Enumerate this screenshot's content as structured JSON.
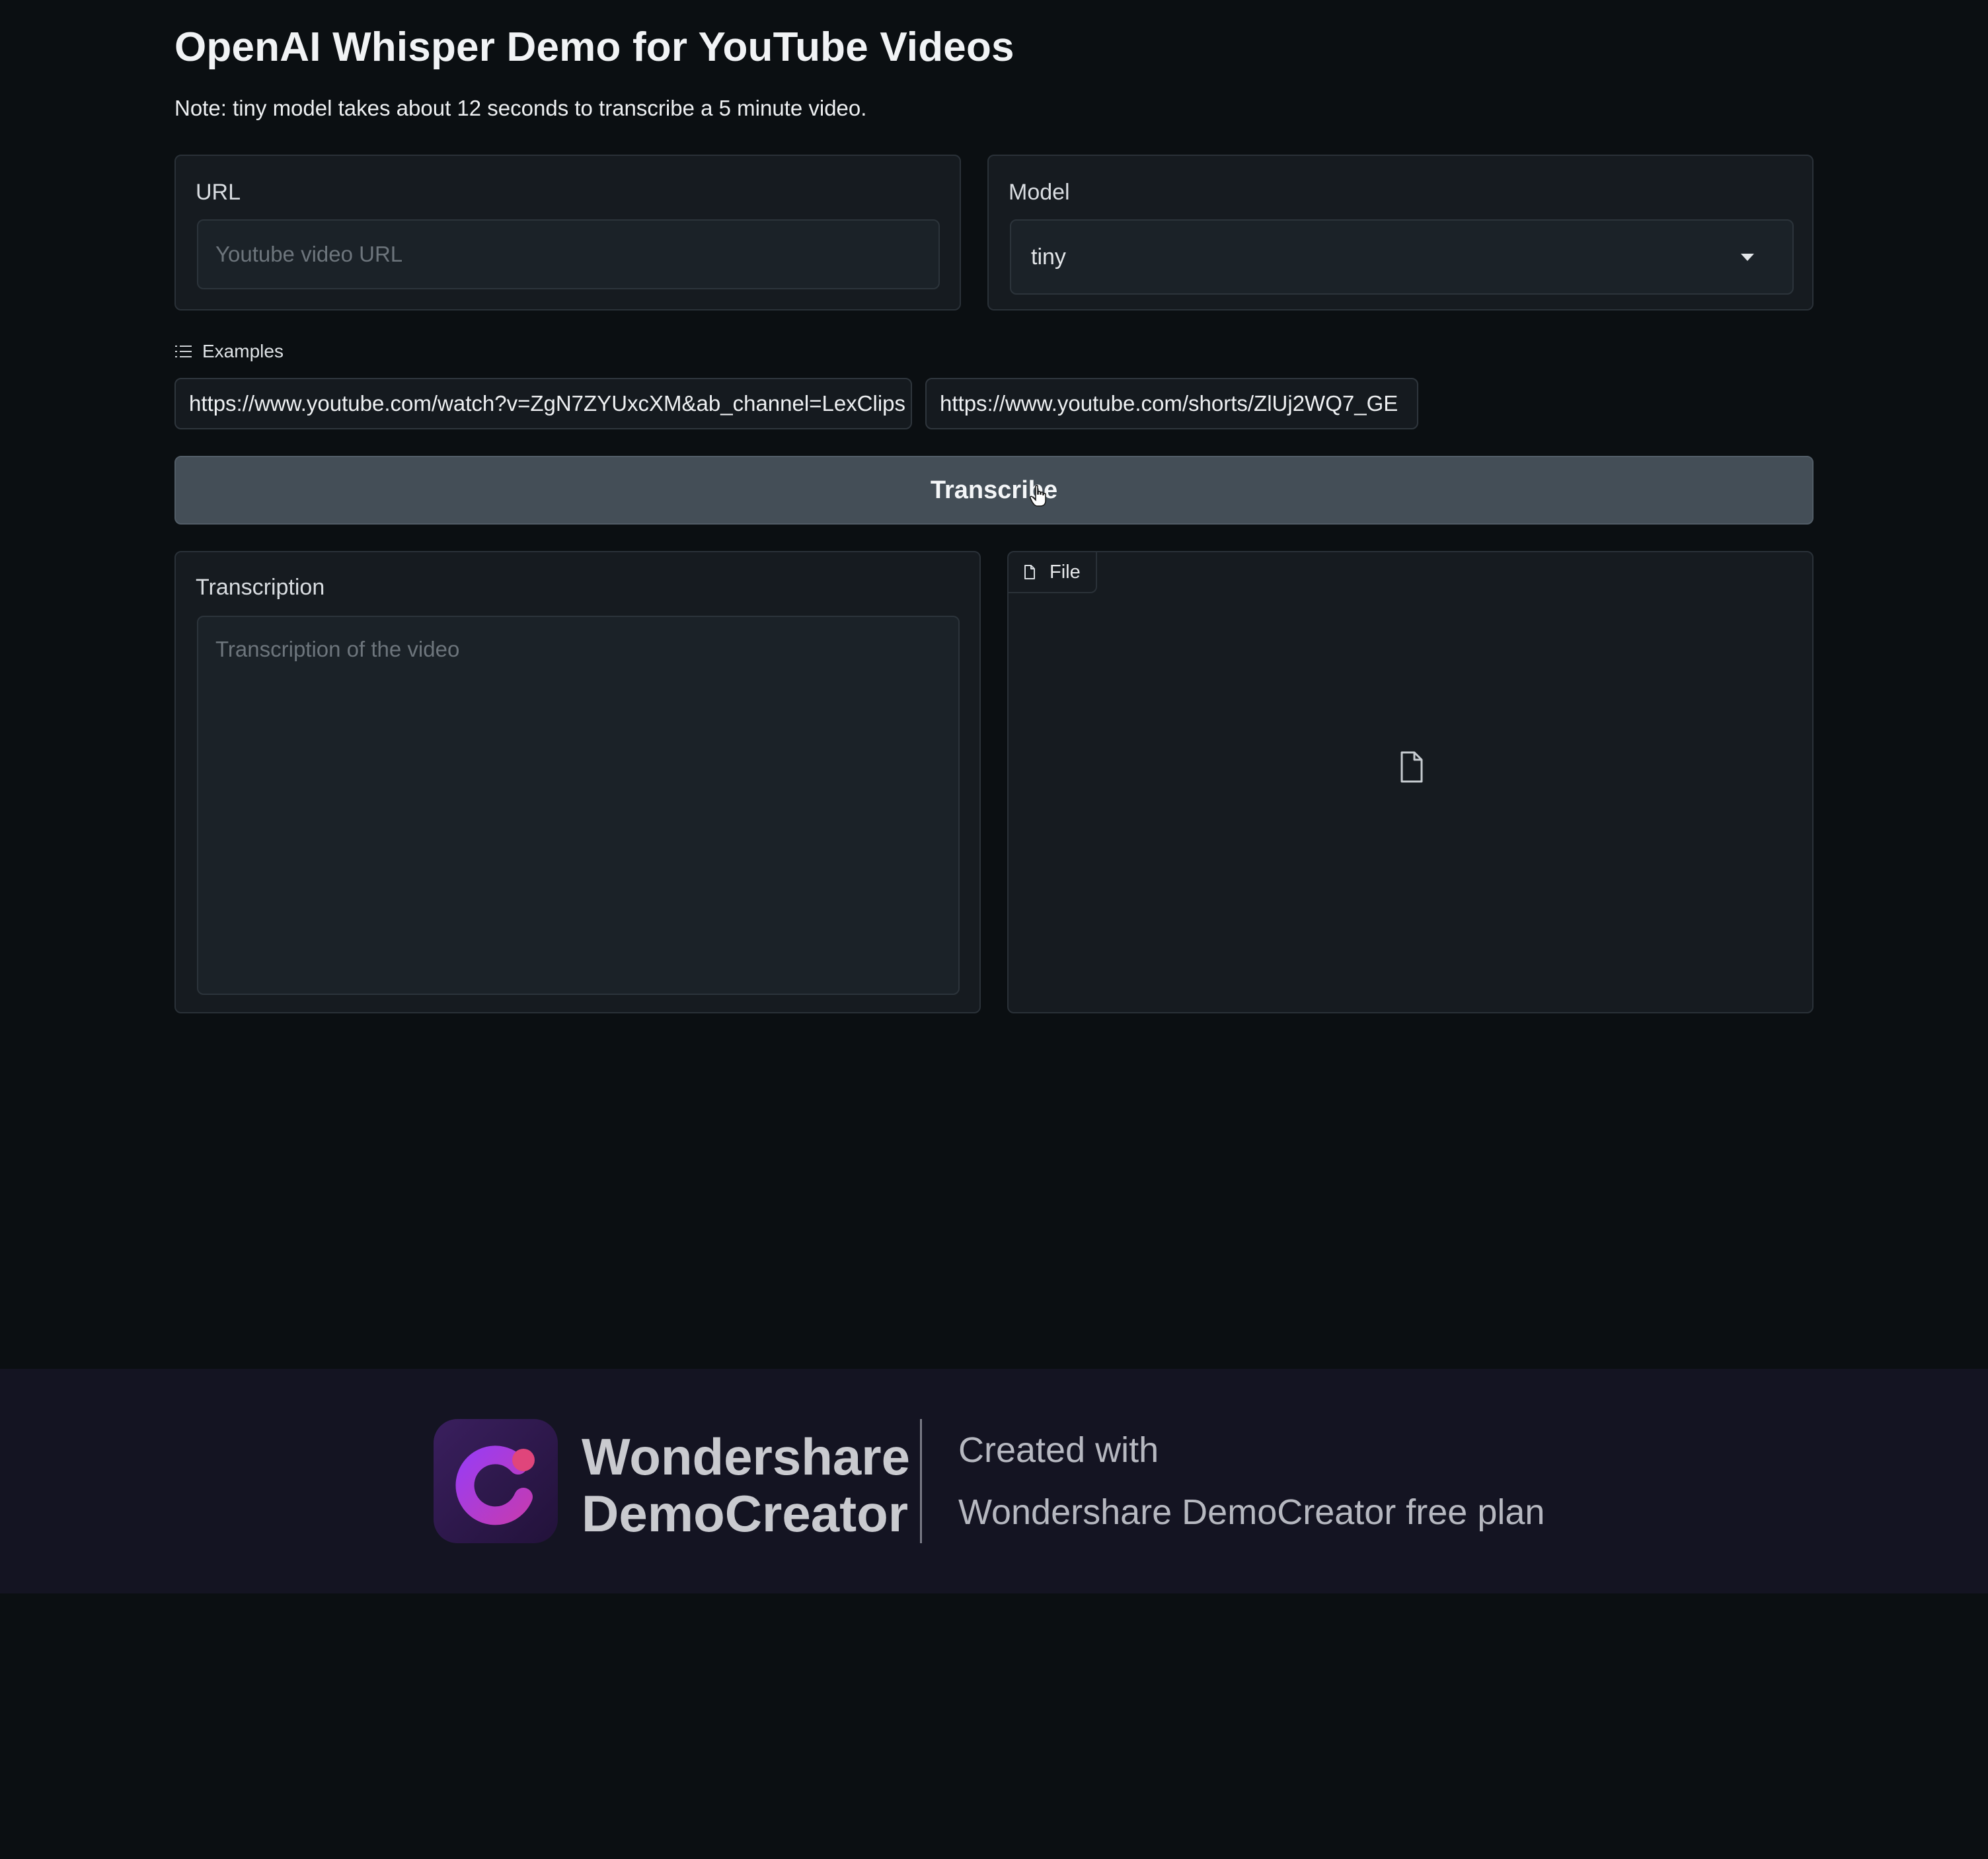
{
  "header": {
    "title": "OpenAI Whisper Demo for YouTube Videos",
    "note": "Note: tiny model takes about 12 seconds to transcribe a 5 minute video."
  },
  "url_field": {
    "label": "URL",
    "placeholder": "Youtube video URL",
    "value": ""
  },
  "model_field": {
    "label": "Model",
    "selected": "tiny"
  },
  "examples": {
    "label": "Examples",
    "items": [
      "https://www.youtube.com/watch?v=ZgN7ZYUxcXM&ab_channel=LexClips",
      "https://www.youtube.com/shorts/ZlUj2WQ7_GE"
    ]
  },
  "actions": {
    "transcribe_label": "Transcribe"
  },
  "transcription": {
    "label": "Transcription",
    "placeholder": "Transcription of the video",
    "value": ""
  },
  "file_output": {
    "label": "File"
  },
  "banner": {
    "brand_line1": "Wondershare",
    "brand_line2": "DemoCreator",
    "created_with": "Created with",
    "plan": "Wondershare DemoCreator free plan"
  },
  "icons": {
    "examples": "list-icon",
    "file_tab": "file-icon",
    "file_empty": "file-icon",
    "cursor": "hand-pointer-icon",
    "logo": "democreator-logo"
  },
  "colors": {
    "background": "#0b0f12",
    "panel": "#161b20",
    "button": "#444e57",
    "banner": "#141422"
  }
}
